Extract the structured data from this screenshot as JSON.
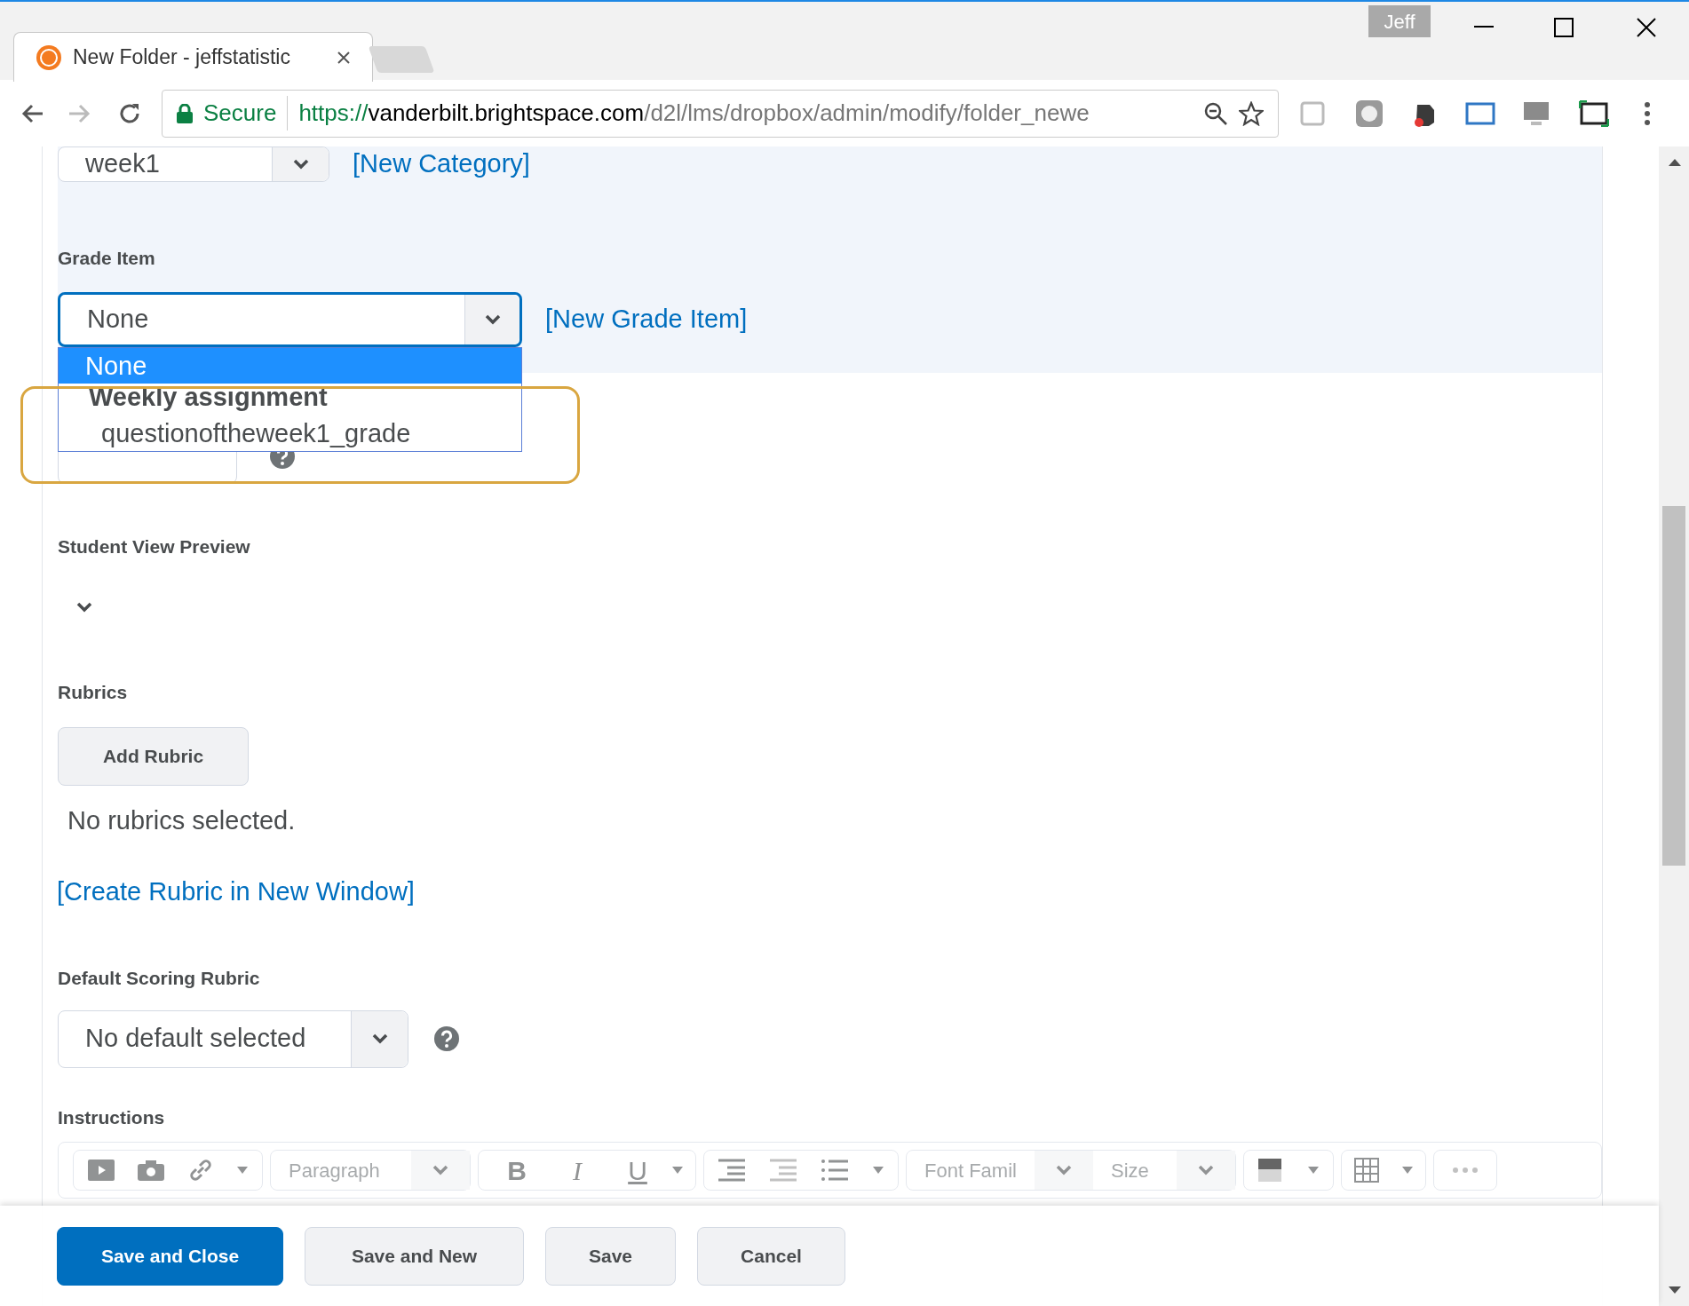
{
  "window": {
    "user_badge": "Jeff"
  },
  "tabs": [
    {
      "title": "New Folder - jeffstatistic",
      "selected": true
    }
  ],
  "address_bar": {
    "secure_label": "Secure",
    "url_scheme": "https://",
    "url_host": "vanderbilt.brightspace.com",
    "url_path": "/d2l/lms/dropbox/admin/modify/folder_newe"
  },
  "category": {
    "value": "week1",
    "link": "[New Category]"
  },
  "grade_item": {
    "label": "Grade Item",
    "value": "None",
    "link": "[New Grade Item]",
    "expanded": true,
    "options": [
      {
        "kind": "option",
        "label": "None",
        "selected": true
      },
      {
        "kind": "group",
        "label": "Weekly assignment",
        "selected": false
      },
      {
        "kind": "option",
        "label": "questionoftheweek1_grade",
        "selected": false
      }
    ]
  },
  "student_view_preview": {
    "label": "Student View Preview"
  },
  "rubrics": {
    "label": "Rubrics",
    "button": "Add Rubric",
    "status": "No rubrics selected.",
    "link": "[Create Rubric in New Window]"
  },
  "default_scoring_rubric": {
    "label": "Default Scoring Rubric",
    "value": "No default selected"
  },
  "instructions": {
    "label": "Instructions",
    "toolbar": {
      "block_format": "Paragraph",
      "format_buttons": [
        "B",
        "I",
        "U"
      ],
      "font_family": "Font Famil",
      "font_size": "Size"
    }
  },
  "footer_buttons": [
    {
      "label": "Save and Close",
      "kind": "primary"
    },
    {
      "label": "Save and New",
      "kind": "secondary"
    },
    {
      "label": "Save",
      "kind": "secondary"
    },
    {
      "label": "Cancel",
      "kind": "secondary"
    }
  ]
}
